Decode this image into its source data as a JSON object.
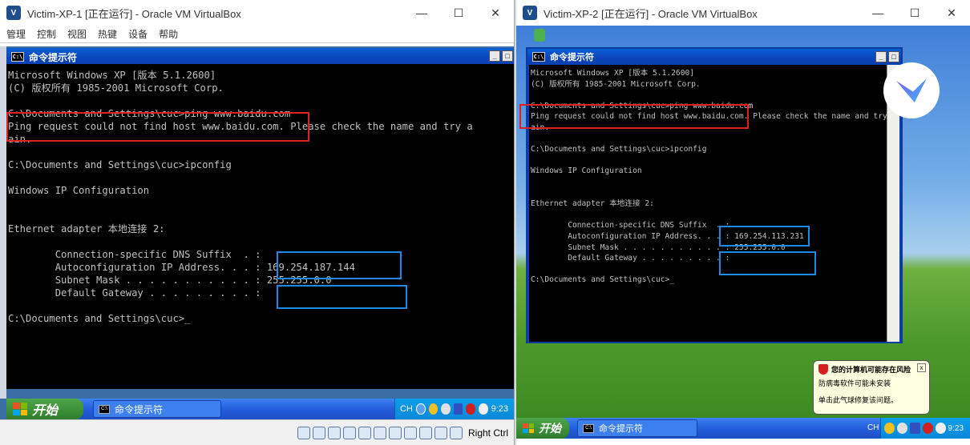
{
  "colors": {
    "annotation_red": "#e02020",
    "annotation_blue": "#1e88e5",
    "xp_blue": "#245edb",
    "xp_green": "#3b8f37"
  },
  "vm1": {
    "window_title": "Victim-XP-1 [正在运行] - Oracle VM VirtualBox",
    "menu": [
      "管理",
      "控制",
      "视图",
      "热键",
      "设备",
      "帮助"
    ],
    "cmd_title": "命令提示符",
    "console_lines": [
      "Microsoft Windows XP [版本 5.1.2600]",
      "(C) 版权所有 1985-2001 Microsoft Corp.",
      "",
      "C:\\Documents and Settings\\cuc>ping www.baidu.com",
      "Ping request could not find host www.baidu.com. Please check the name and try a",
      "ain.",
      "",
      "C:\\Documents and Settings\\cuc>ipconfig",
      "",
      "Windows IP Configuration",
      "",
      "",
      "Ethernet adapter 本地连接 2:",
      "",
      "        Connection-specific DNS Suffix  . :",
      "        Autoconfiguration IP Address. . . : 169.254.187.144",
      "        Subnet Mask . . . . . . . . . . . : 255.255.0.0",
      "        Default Gateway . . . . . . . . . :",
      "",
      "C:\\Documents and Settings\\cuc>_"
    ],
    "start_label": "开始",
    "task_item": "命令提示符",
    "tray_lang": "CH",
    "clock": "9:23",
    "host_key": "Right Ctrl"
  },
  "vm2": {
    "window_title": "Victim-XP-2 [正在运行] - Oracle VM VirtualBox",
    "cmd_title": "命令提示符",
    "console_lines": [
      "Microsoft Windows XP [版本 5.1.2600]",
      "(C) 版权所有 1985-2001 Microsoft Corp.",
      "",
      "C:\\Documents and Settings\\cuc>ping www.baidu.com",
      "Ping request could not find host www.baidu.com. Please check the name and try ag",
      "ain.",
      "",
      "C:\\Documents and Settings\\cuc>ipconfig",
      "",
      "Windows IP Configuration",
      "",
      "",
      "Ethernet adapter 本地连接 2:",
      "",
      "        Connection-specific DNS Suffix  . :",
      "        Autoconfiguration IP Address. . . : 169.254.113.231",
      "        Subnet Mask . . . . . . . . . . . : 255.255.0.0",
      "        Default Gateway . . . . . . . . . :",
      "",
      "C:\\Documents and Settings\\cuc>_"
    ],
    "balloon": {
      "title": "您的计算机可能存在风险",
      "line1": "防病毒软件可能未安装",
      "line2": "单击此气球修复该问题。"
    },
    "start_label": "开始",
    "task_item": "命令提示符",
    "tray_lang": "CH",
    "clock": "9:23"
  }
}
